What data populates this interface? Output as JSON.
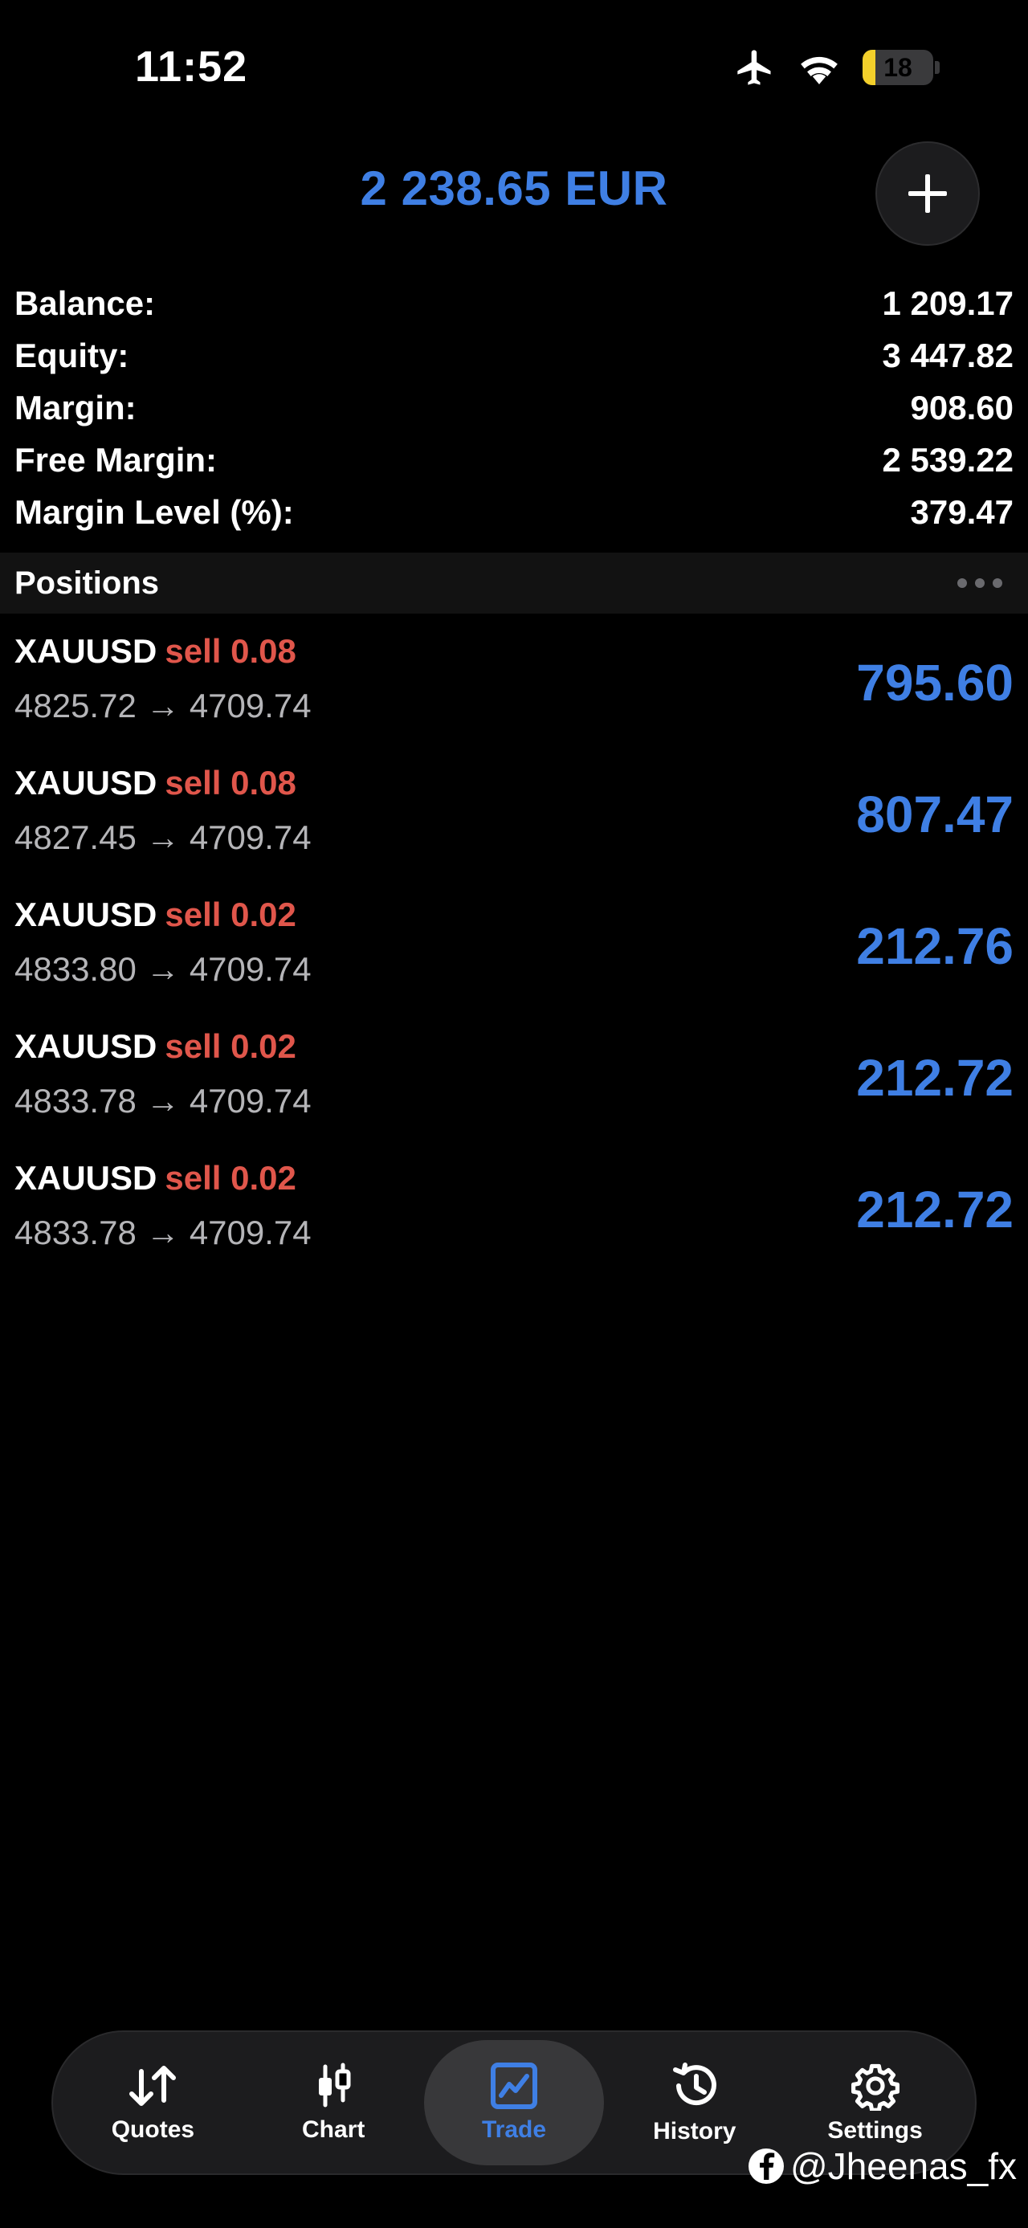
{
  "status_bar": {
    "time": "11:52",
    "battery": "18"
  },
  "header": {
    "total": "2 238.65 EUR"
  },
  "account": [
    {
      "label": "Balance:",
      "value": "1 209.17"
    },
    {
      "label": "Equity:",
      "value": "3 447.82"
    },
    {
      "label": "Margin:",
      "value": "908.60"
    },
    {
      "label": "Free Margin:",
      "value": "2 539.22"
    },
    {
      "label": "Margin Level (%):",
      "value": "379.47"
    }
  ],
  "positions_header": {
    "title": "Positions"
  },
  "positions": [
    {
      "symbol": "XAUUSD",
      "side": "sell 0.08",
      "open": "4825.72",
      "arrow": "→",
      "current": "4709.74",
      "profit": "795.60"
    },
    {
      "symbol": "XAUUSD",
      "side": "sell 0.08",
      "open": "4827.45",
      "arrow": "→",
      "current": "4709.74",
      "profit": "807.47"
    },
    {
      "symbol": "XAUUSD",
      "side": "sell 0.02",
      "open": "4833.80",
      "arrow": "→",
      "current": "4709.74",
      "profit": "212.76"
    },
    {
      "symbol": "XAUUSD",
      "side": "sell 0.02",
      "open": "4833.78",
      "arrow": "→",
      "current": "4709.74",
      "profit": "212.72"
    },
    {
      "symbol": "XAUUSD",
      "side": "sell 0.02",
      "open": "4833.78",
      "arrow": "→",
      "current": "4709.74",
      "profit": "212.72"
    }
  ],
  "tabs": [
    {
      "label": "Quotes",
      "icon": "quotes-icon"
    },
    {
      "label": "Chart",
      "icon": "chart-icon"
    },
    {
      "label": "Trade",
      "icon": "trade-icon",
      "active": true
    },
    {
      "label": "History",
      "icon": "history-icon"
    },
    {
      "label": "Settings",
      "icon": "gear-icon"
    }
  ],
  "watermark": {
    "text": "@Jheenas_fx"
  },
  "colors": {
    "accent": "#3f7fe4",
    "sell": "#e0564b",
    "background": "#000000",
    "battery": "#f3d02b"
  }
}
